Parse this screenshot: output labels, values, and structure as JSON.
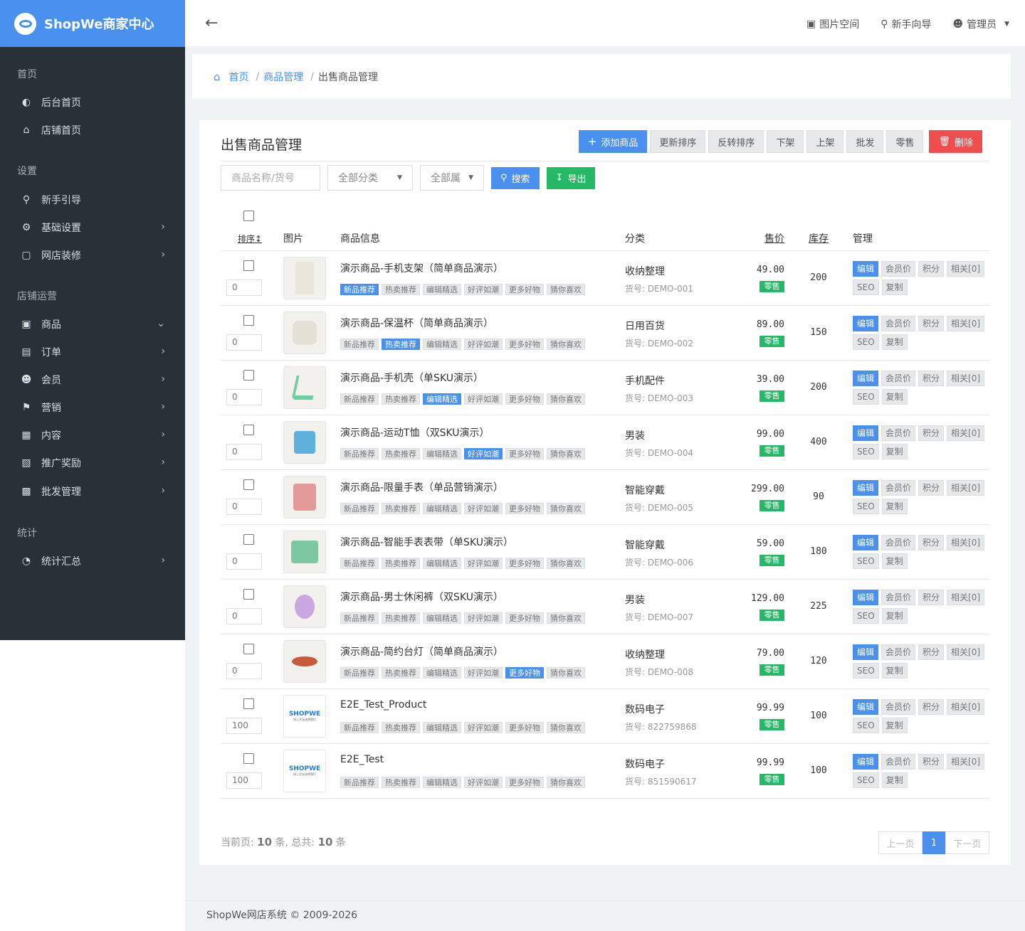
{
  "brand": {
    "name": "ShopWe商家中心"
  },
  "topbar": {
    "gallery": "图片空间",
    "guide": "新手向导",
    "user": "管理员"
  },
  "sidebar": {
    "groups": [
      "首页",
      "设置",
      "店铺运营",
      "统计"
    ],
    "items": [
      {
        "label": "后台首页",
        "icon": "dashboard-icon",
        "chevron": false
      },
      {
        "label": "店铺首页",
        "icon": "home-icon",
        "chevron": false
      },
      {
        "label": "新手引导",
        "icon": "map-pin-icon",
        "chevron": false
      },
      {
        "label": "基础设置",
        "icon": "gear-icon",
        "chevron": true
      },
      {
        "label": "网店装修",
        "icon": "monitor-icon",
        "chevron": true
      },
      {
        "label": "商品",
        "icon": "cart-icon",
        "chevron": true
      },
      {
        "label": "订单",
        "icon": "order-icon",
        "chevron": true
      },
      {
        "label": "会员",
        "icon": "user-icon",
        "chevron": true
      },
      {
        "label": "营销",
        "icon": "flag-icon",
        "chevron": true
      },
      {
        "label": "内容",
        "icon": "book-icon",
        "chevron": true
      },
      {
        "label": "推广奖励",
        "icon": "clipboard-icon",
        "chevron": true
      },
      {
        "label": "批发管理",
        "icon": "briefcase-icon",
        "chevron": true
      },
      {
        "label": "统计汇总",
        "icon": "pie-chart-icon",
        "chevron": true
      }
    ]
  },
  "breadcrumb": {
    "home": "首页",
    "parent": "商品管理",
    "current": "出售商品管理",
    "sep": "/"
  },
  "page": {
    "title": "出售商品管理"
  },
  "actions": {
    "add": "添加商品",
    "resort": "更新排序",
    "reverse": "反转排序",
    "offline": "下架",
    "online": "上架",
    "wholesale": "批发",
    "retail": "零售",
    "delete": "删除"
  },
  "filters": {
    "search_placeholder": "商品名称/货号",
    "category": "全部分类",
    "attr": "全部属",
    "search": "搜索",
    "export": "导出"
  },
  "table": {
    "headers": {
      "sort": "排序↕",
      "image": "图片",
      "info": "商品信息",
      "category": "分类",
      "price": "售价",
      "stock": "库存",
      "manage": "管理"
    },
    "tag_labels": [
      "新品推荐",
      "热卖推荐",
      "编辑精选",
      "好评如潮",
      "更多好物",
      "猜你喜欢"
    ],
    "sku_prefix": "货号:",
    "retail_badge": "零售",
    "manage_labels": [
      "编辑",
      "会员价",
      "积分",
      "相关[0]",
      "SEO",
      "复制"
    ],
    "rows": [
      {
        "sort": "0",
        "name": "演示商品-手机支架（简单商品演示）",
        "active_tag": 0,
        "category": "收纳整理",
        "sku": "DEMO-001",
        "price": "49.00",
        "stock": "200",
        "thumb": "pants"
      },
      {
        "sort": "0",
        "name": "演示商品-保温杯（简单商品演示）",
        "active_tag": 1,
        "category": "日用百货",
        "sku": "DEMO-002",
        "price": "89.00",
        "stock": "150",
        "thumb": "cup"
      },
      {
        "sort": "0",
        "name": "演示商品-手机壳（单SKU演示）",
        "active_tag": 2,
        "category": "手机配件",
        "sku": "DEMO-003",
        "price": "39.00",
        "stock": "200",
        "thumb": "lamp"
      },
      {
        "sort": "0",
        "name": "演示商品-运动T恤（双SKU演示）",
        "active_tag": 3,
        "category": "男装",
        "sku": "DEMO-004",
        "price": "99.00",
        "stock": "400",
        "thumb": "kettle"
      },
      {
        "sort": "0",
        "name": "演示商品-限量手表（单品营销演示）",
        "active_tag": -1,
        "category": "智能穿戴",
        "sku": "DEMO-005",
        "price": "299.00",
        "stock": "90",
        "thumb": "top"
      },
      {
        "sort": "0",
        "name": "演示商品-智能手表表带（单SKU演示）",
        "active_tag": -1,
        "category": "智能穿戴",
        "sku": "DEMO-006",
        "price": "59.00",
        "stock": "180",
        "thumb": "sweater"
      },
      {
        "sort": "0",
        "name": "演示商品-男士休闲裤（双SKU演示）",
        "active_tag": -1,
        "category": "男装",
        "sku": "DEMO-007",
        "price": "129.00",
        "stock": "225",
        "thumb": "vase"
      },
      {
        "sort": "0",
        "name": "演示商品-简约台灯（简单商品演示）",
        "active_tag": 4,
        "category": "收纳整理",
        "sku": "DEMO-008",
        "price": "79.00",
        "stock": "120",
        "thumb": "plate"
      },
      {
        "sort": "100",
        "name": "E2E_Test_Product",
        "active_tag": -1,
        "category": "数码电子",
        "sku": "822759868",
        "price": "99.99",
        "stock": "100",
        "thumb": "logo"
      },
      {
        "sort": "100",
        "name": "E2E_Test",
        "active_tag": -1,
        "category": "数码电子",
        "sku": "851590617",
        "price": "99.99",
        "stock": "100",
        "thumb": "logo"
      }
    ]
  },
  "thumb_logo": {
    "word": "SHOPWE",
    "sub": "线上开店选择我们"
  },
  "pagination": {
    "text_prefix": "当前页:",
    "current_count": "10",
    "unit1": "条,",
    "text_total": "总共:",
    "total_count": "10",
    "unit2": "条",
    "prev": "上一页",
    "page": "1",
    "next": "下一页"
  },
  "footer": {
    "text": "ShopWe网店系统 © 2009-2026"
  },
  "colors": {
    "accent": "#4a90ef",
    "sidebar": "#283137",
    "danger": "#f04e4e",
    "success": "#25b867"
  }
}
